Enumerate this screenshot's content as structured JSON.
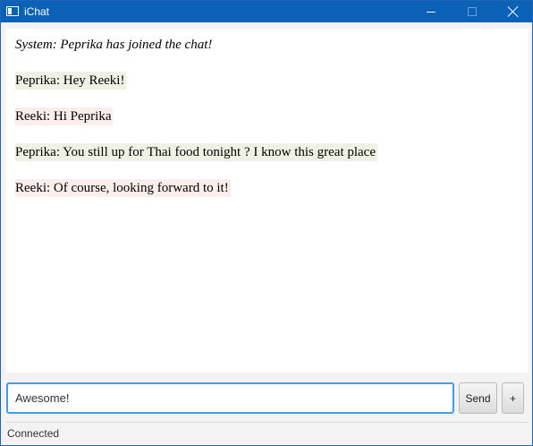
{
  "window": {
    "title": "iChat",
    "title_bar_color": "#0a61b5"
  },
  "chat": {
    "messages": [
      {
        "kind": "system",
        "text": "System: Peprika has joined the chat!"
      },
      {
        "kind": "peprika",
        "text": "Peprika: Hey Reeki!"
      },
      {
        "kind": "reeki",
        "text": "Reeki: Hi Peprika"
      },
      {
        "kind": "peprika",
        "text": "Peprika: You still up for Thai food tonight ? I know this great place"
      },
      {
        "kind": "reeki",
        "text": "Reeki: Of course, looking forward to it!"
      }
    ],
    "colors": {
      "peprika_bg": "#eef1e3",
      "reeki_bg": "#fdeeee"
    }
  },
  "composer": {
    "input_value": "Awesome!",
    "send_label": "Send",
    "plus_label": "+"
  },
  "status": {
    "text": "Connected"
  }
}
